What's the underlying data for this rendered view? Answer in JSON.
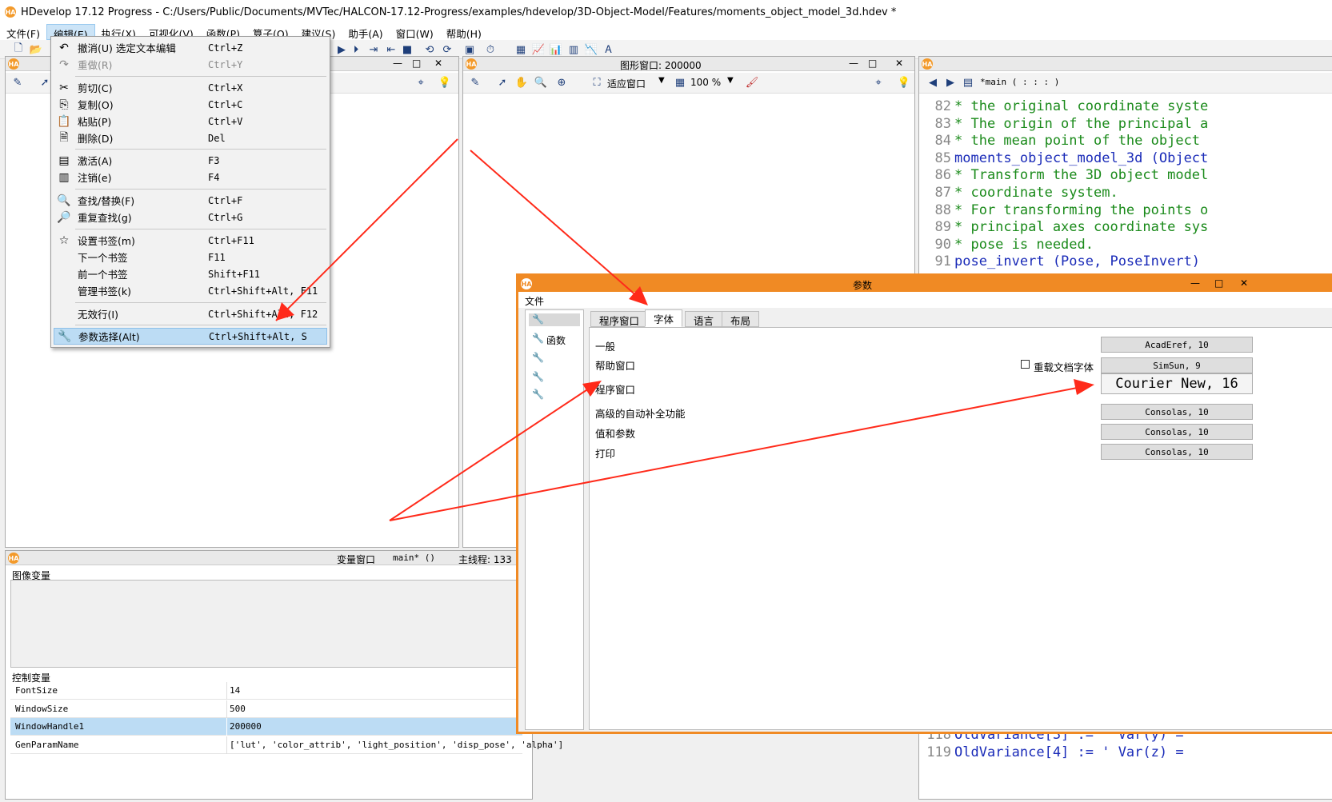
{
  "window": {
    "title": "HDevelop 17.12 Progress - C:/Users/Public/Documents/MVTec/HALCON-17.12-Progress/examples/hdevelop/3D-Object-Model/Features/moments_object_model_3d.hdev *",
    "logo": "HA"
  },
  "menubar": [
    "文件(F)",
    "编辑(E)",
    "执行(X)",
    "可视化(V)",
    "函数(P)",
    "算子(O)",
    "建议(S)",
    "助手(A)",
    "窗口(W)",
    "帮助(H)"
  ],
  "edit_menu": {
    "items": [
      {
        "icon": "undo-icon",
        "glyph": "↶",
        "label": "撤消(U) 选定文本编辑",
        "shortcut": "Ctrl+Z",
        "disabled": false
      },
      {
        "icon": "redo-icon",
        "glyph": "↷",
        "label": "重做(R)",
        "shortcut": "Ctrl+Y",
        "disabled": true
      },
      {
        "icon": "cut-icon",
        "glyph": "✂",
        "label": "剪切(C)",
        "shortcut": "Ctrl+X",
        "disabled": false
      },
      {
        "icon": "copy-icon",
        "glyph": "⎘",
        "label": "复制(O)",
        "shortcut": "Ctrl+C",
        "disabled": false
      },
      {
        "icon": "paste-icon",
        "glyph": "📋",
        "label": "粘贴(P)",
        "shortcut": "Ctrl+V",
        "disabled": false
      },
      {
        "icon": "delete-icon",
        "glyph": "🗎",
        "label": "删除(D)",
        "shortcut": "Del",
        "disabled": false
      },
      {
        "icon": "activate-icon",
        "glyph": "▤",
        "label": "激活(A)",
        "shortcut": "F3",
        "disabled": false
      },
      {
        "icon": "deactivate-icon",
        "glyph": "▥",
        "label": "注销(e)",
        "shortcut": "F4",
        "disabled": false
      },
      {
        "icon": "find-replace-icon",
        "glyph": "🔍",
        "label": "查找/替换(F)",
        "shortcut": "Ctrl+F",
        "disabled": false
      },
      {
        "icon": "find-again-icon",
        "glyph": "🔎",
        "label": "重复查找(g)",
        "shortcut": "Ctrl+G",
        "disabled": false
      },
      {
        "icon": "bookmark-icon",
        "glyph": "☆",
        "label": "设置书签(m)",
        "shortcut": "Ctrl+F11",
        "disabled": false
      },
      {
        "icon": "",
        "glyph": "",
        "label": "下一个书签",
        "shortcut": "F11",
        "disabled": false
      },
      {
        "icon": "",
        "glyph": "",
        "label": "前一个书签",
        "shortcut": "Shift+F11",
        "disabled": false
      },
      {
        "icon": "",
        "glyph": "",
        "label": "管理书签(k)",
        "shortcut": "Ctrl+Shift+Alt, F11",
        "disabled": false
      },
      {
        "icon": "",
        "glyph": "",
        "label": "无效行(I)",
        "shortcut": "Ctrl+Shift+Alt, F12",
        "disabled": false
      },
      {
        "icon": "wrench-icon",
        "glyph": "🔧",
        "label": "参数选择(Alt)",
        "shortcut": "Ctrl+Shift+Alt, S",
        "disabled": false,
        "selected": true
      }
    ]
  },
  "graphics_window": {
    "title": "图形窗口: 200000",
    "fit_label": "适应窗口",
    "zoom_label": "100 %"
  },
  "program_window": {
    "procedure_label": "*main ( : : : )",
    "lines": [
      {
        "n": "82",
        "text": "* the original coordinate syste",
        "kind": "cm"
      },
      {
        "n": "83",
        "text": "* The origin of the principal a",
        "kind": "cm"
      },
      {
        "n": "84",
        "text": "* the mean point of the object",
        "kind": "cm"
      },
      {
        "n": "85",
        "text": "moments_object_model_3d (Object",
        "kind": "op"
      },
      {
        "n": "86",
        "text": "* Transform the 3D object model",
        "kind": "cm"
      },
      {
        "n": "87",
        "text": "* coordinate system.",
        "kind": "cm"
      },
      {
        "n": "88",
        "text": "* For transforming the points o",
        "kind": "cm"
      },
      {
        "n": "89",
        "text": "* principal axes coordinate sys",
        "kind": "cm"
      },
      {
        "n": "90",
        "text": "* pose is needed.",
        "kind": "cm"
      },
      {
        "n": "91",
        "text": "pose_invert (Pose, PoseInvert)",
        "kind": "op"
      }
    ],
    "bottom_lines": [
      {
        "n": "118",
        "text": "OldVariance[3] := ' Var(y) ="
      },
      {
        "n": "119",
        "text": "OldVariance[4] := ' Var(z) ="
      }
    ]
  },
  "variable_window": {
    "title": "变量窗口",
    "procedure": "main* ()",
    "thread": "主线程: 133",
    "iconic_header": "图像变量",
    "control_header": "控制变量",
    "rows": [
      {
        "name": "FontSize",
        "value": "14",
        "selected": false
      },
      {
        "name": "WindowSize",
        "value": "500",
        "selected": false
      },
      {
        "name": "WindowHandle1",
        "value": "200000",
        "selected": true
      },
      {
        "name": "GenParamName",
        "value": "['lut', 'color_attrib', 'light_position', 'disp_pose', 'alpha']",
        "selected": false
      }
    ]
  },
  "preferences_dialog": {
    "title": "参数",
    "menu": "文件",
    "sidebar": [
      {
        "icon": "font-tool-icon",
        "label": ""
      },
      {
        "icon": "function-icon",
        "label": "函数"
      },
      {
        "icon": "tool-icon-1",
        "label": ""
      },
      {
        "icon": "tool-icon-2",
        "label": ""
      },
      {
        "icon": "tool-icon-3",
        "label": ""
      }
    ],
    "tabs": [
      "程序窗口",
      "字体",
      "语言",
      "布局"
    ],
    "active_tab": 1,
    "rows": [
      {
        "label": "一般",
        "font": "AcadEref, 10"
      },
      {
        "label": "帮助窗口",
        "font": "SimSun, 9",
        "checkbox": "重载文档字体"
      },
      {
        "label": "程序窗口",
        "font": "Courier New, 16"
      },
      {
        "label": "高级的自动补全功能",
        "font": "Consolas, 10"
      },
      {
        "label": "值和参数",
        "font": "Consolas, 10"
      },
      {
        "label": "打印",
        "font": "Consolas, 10"
      }
    ]
  },
  "colors": {
    "accent_orange": "#f08a24",
    "arrow_red": "#ff2a1a",
    "comment_green": "#1a8a1a",
    "operator_blue": "#1a2bb8",
    "selection_blue": "#bcdcf4"
  }
}
